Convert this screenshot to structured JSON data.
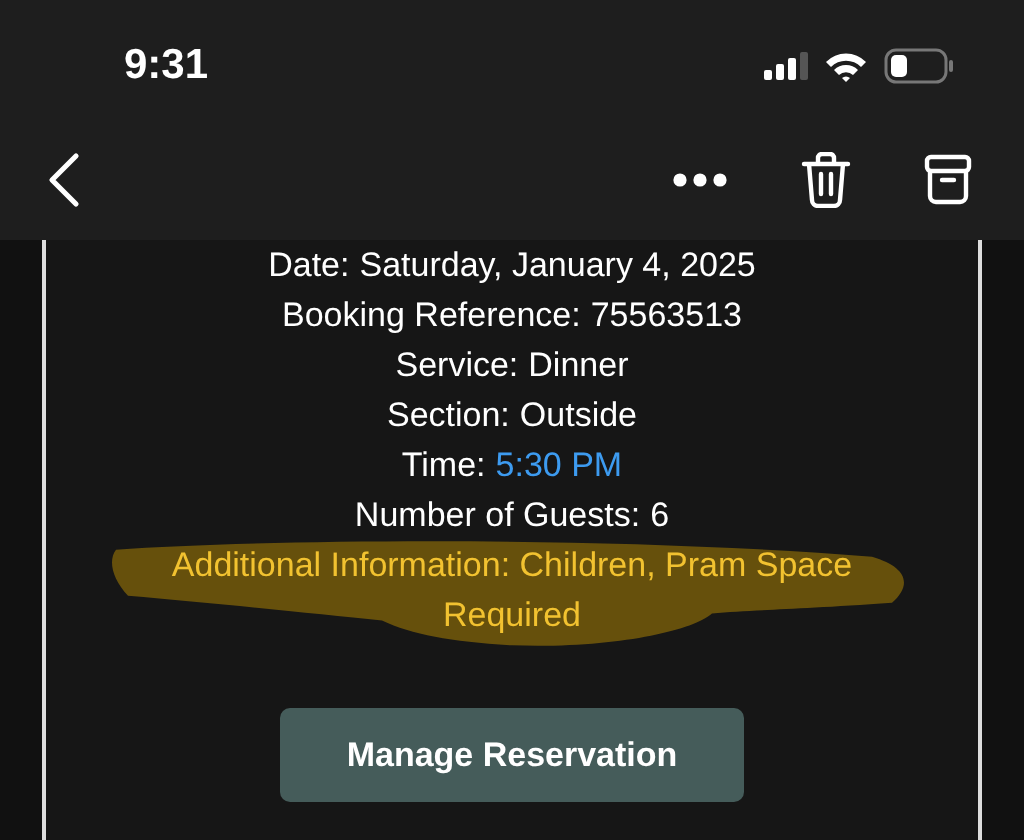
{
  "status_bar": {
    "time": "9:31"
  },
  "details": [
    {
      "kind": "plain",
      "label": "Date:",
      "value": "Saturday, January 4, 2025"
    },
    {
      "kind": "plain",
      "label": "Booking Reference:",
      "value": "75563513"
    },
    {
      "kind": "plain",
      "label": "Service:",
      "value": "Dinner"
    },
    {
      "kind": "plain",
      "label": "Section:",
      "value": "Outside"
    },
    {
      "kind": "link",
      "label": "Time:",
      "value": "5:30 PM"
    },
    {
      "kind": "plain",
      "label": "Number of Guests:",
      "value": "6"
    },
    {
      "kind": "highlight",
      "label": "Additional Information:",
      "value": "Children, Pram Space Required"
    }
  ],
  "button": {
    "label": "Manage Reservation"
  }
}
